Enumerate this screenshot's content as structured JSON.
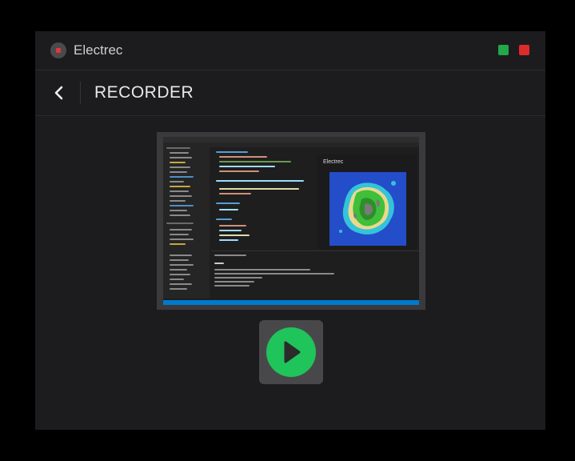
{
  "app": {
    "title": "Electrec"
  },
  "header": {
    "title": "RECORDER"
  },
  "preview": {
    "webview_title": "Electrec"
  },
  "icons": {
    "logo": "record-icon",
    "back": "chevron-left-icon",
    "play": "play-icon",
    "maximize": "green-square-icon",
    "close": "red-square-icon"
  },
  "colors": {
    "window_bg": "#1c1c1e",
    "play_green": "#1fc45a",
    "record_red": "#e0373b",
    "window_green": "#21a94a",
    "window_red": "#df2a2a"
  }
}
